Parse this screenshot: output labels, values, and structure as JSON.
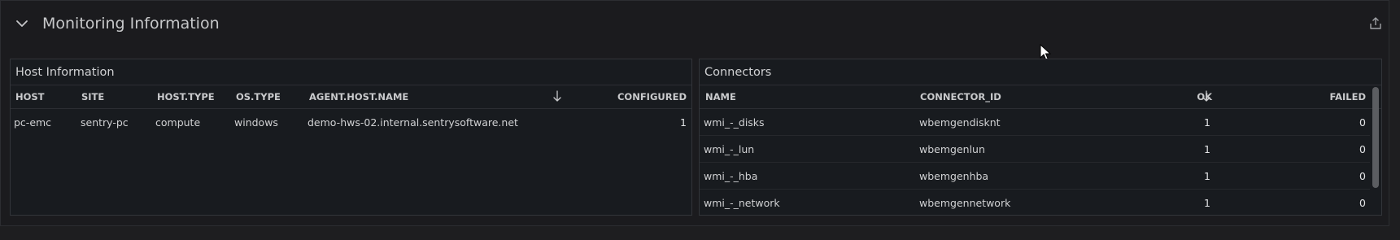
{
  "row": {
    "title": "Monitoring Information"
  },
  "icons": {
    "collapse": "chevron-down-icon",
    "share": "share-icon",
    "sort": "arrow-down-icon"
  },
  "colors": {
    "background": "#1b1b1e",
    "panel": "#181b1f",
    "border": "#33353a",
    "text": "#d0d1d3"
  },
  "host_panel": {
    "title": "Host Information",
    "columns": [
      "HOST",
      "SITE",
      "HOST.TYPE",
      "OS.TYPE",
      "AGENT.HOST.NAME",
      "CONFIGURED"
    ],
    "sorted_column": "CONFIGURED",
    "rows": [
      [
        "pc-emc",
        "sentry-pc",
        "compute",
        "windows",
        "demo-hws-02.internal.sentrysoftware.net",
        "1"
      ]
    ]
  },
  "connectors_panel": {
    "title": "Connectors",
    "columns": [
      "NAME",
      "CONNECTOR_ID",
      "OK",
      "FAILED"
    ],
    "sorted_column": "OK",
    "rows": [
      [
        "wmi_-_disks",
        "wbemgendisknt",
        "1",
        "0"
      ],
      [
        "wmi_-_lun",
        "wbemgenlun",
        "1",
        "0"
      ],
      [
        "wmi_-_hba",
        "wbemgenhba",
        "1",
        "0"
      ],
      [
        "wmi_-_network",
        "wbemgennetwork",
        "1",
        "0"
      ]
    ]
  }
}
